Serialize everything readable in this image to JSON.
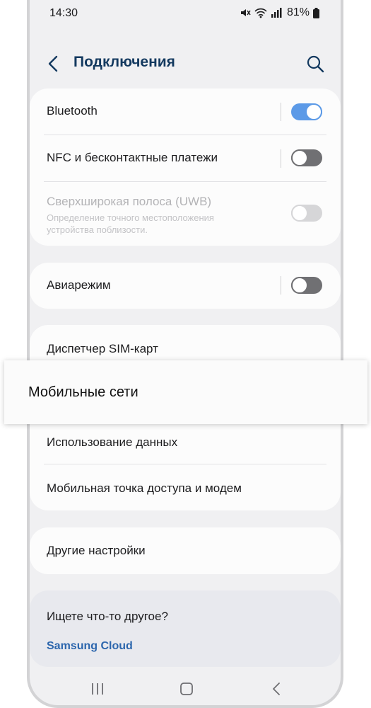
{
  "status": {
    "time": "14:30",
    "battery": "81%"
  },
  "appbar": {
    "title": "Подключения",
    "back_icon": "chevron-left-icon",
    "search_icon": "search-icon"
  },
  "group1": {
    "bluetooth": {
      "label": "Bluetooth",
      "toggle": "on"
    },
    "nfc": {
      "label": "NFC и бесконтактные платежи",
      "toggle": "off"
    },
    "uwb": {
      "label": "Сверхширокая полоса (UWB)",
      "sub": "Определение точного местоположения устройства поблизости.",
      "toggle": "disabled"
    }
  },
  "group2": {
    "airplane": {
      "label": "Авиарежим",
      "toggle": "off"
    }
  },
  "group3": {
    "sim_manager": "Диспетчер SIM-карт",
    "mobile_networks": "Мобильные сети",
    "data_usage": "Использование данных",
    "hotspot": "Мобильная точка доступа и модем"
  },
  "group4": {
    "other": "Другие настройки"
  },
  "find_more": {
    "title": "Ищете что-то другое?",
    "link": "Samsung Cloud"
  },
  "colors": {
    "accent": "#5c9ae7",
    "title": "#13395f",
    "link": "#2c66ad",
    "background": "#f0f0f2",
    "card": "#fcfcfc"
  }
}
